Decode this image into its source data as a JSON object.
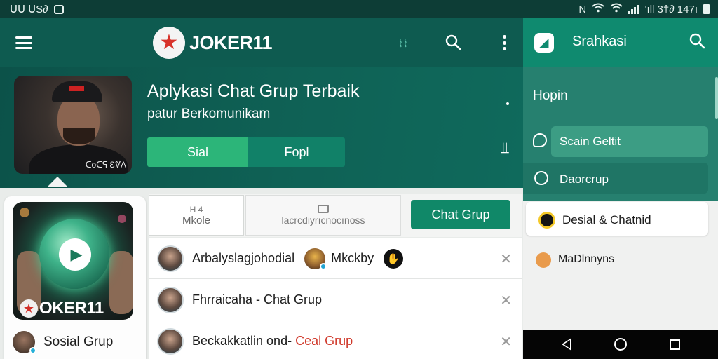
{
  "status_bar": {
    "left_text": "ᑌᑌ ᑌS∂",
    "right_text": "’ıll 3†∂ 147ı"
  },
  "header": {
    "brand": "JOKER11"
  },
  "hero": {
    "title": "Aplykasi Chat Grup Terbaik",
    "subtitle": "patur Berkomunikam",
    "photo_caption": "ᑕoᑕᕋ ƐᕓΛ",
    "primary_button": "Sial",
    "secondary_button": "Fopl"
  },
  "left_card": {
    "brand": "OKER11",
    "footer_label": "Sosial Grup"
  },
  "tabs": {
    "tab1_icon_text": "H 4",
    "tab1_label": "Mkole",
    "tab2_label": "Ɩacrcdiyrıcnocınoss",
    "tab3_label": "Chat Grup"
  },
  "chats": [
    {
      "name": "Arbalyslagjohodial",
      "extra_name": "Mkckby"
    },
    {
      "name": "Fhrraicaha - Chat Grup"
    },
    {
      "name_prefix": "Beckakkatlin ond- ",
      "name_accent": "Ceal Grup"
    }
  ],
  "drawer": {
    "title": "Srahkasi",
    "section": "Hopin",
    "items": [
      "Scain Geltit",
      "Daorcrup",
      "Desial & Chatnid",
      "MaDlnnyns"
    ]
  },
  "colors": {
    "header": "#0e5b50",
    "accent_green": "#2cb579",
    "button_green": "#108868",
    "drawer": "#1a7c6a",
    "accent_red": "#d0392b"
  }
}
